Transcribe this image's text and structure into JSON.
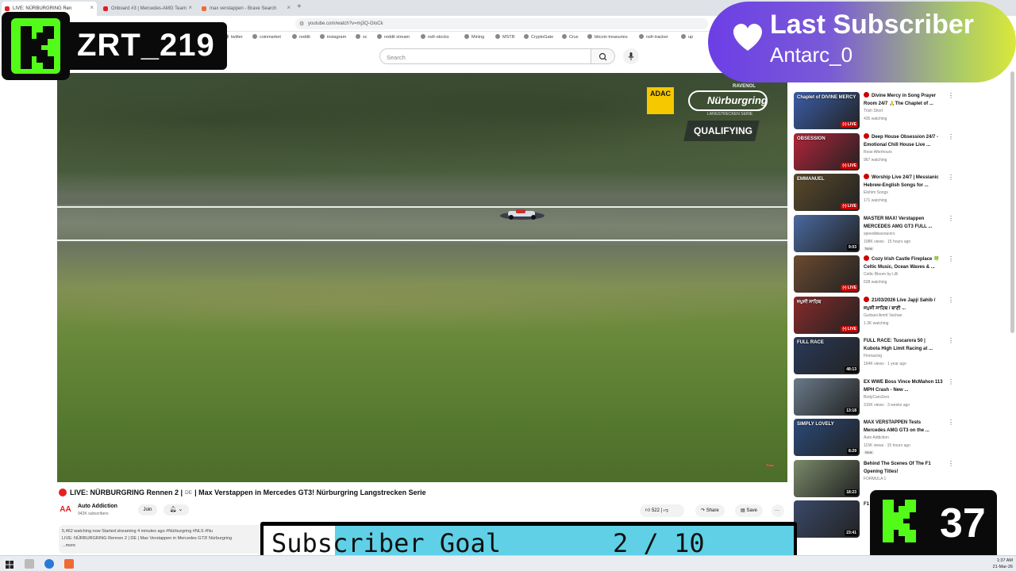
{
  "browser": {
    "tabs": [
      {
        "title": "LIVE: NÜRBURGRING Ren"
      },
      {
        "title": "Onboard #3 | Mercedes-AMG Team"
      },
      {
        "title": "max verstappen - Brave Search"
      }
    ],
    "url": "youtube.com/watch?v=mj3Q-GloCk",
    "bookmarks": [
      "twitter",
      "coinmarket",
      "reddit",
      "instagram",
      "sc",
      "reddit stream",
      "nsfr-stocks",
      "Mining",
      "MSTR",
      "CryptoGate",
      "Crux",
      "bitcoin treasuries",
      "nsfr-tracker",
      "up"
    ]
  },
  "header": {
    "search_placeholder": "Search"
  },
  "video": {
    "sponsor": "ADAC",
    "series_top": "RAVENOL",
    "series_name": "Nürburgring",
    "series_sub": "LANGSTRECKEN SERIE",
    "session": "QUALIFYING",
    "title": "LIVE: NÜRBURGRING Rennen 2 |",
    "lang": "DE",
    "title_rest": "| Max Verstappen in Mercedes GT3! Nürburgring Langstrecken Serie",
    "channel": "Auto Addiction",
    "subscribers": "942K subscribers",
    "join": "Join",
    "likes": "522",
    "share": "Share",
    "save": "Save",
    "desc_line1": "5,462 watching now  Started streaming 4 minutes ago  #Nürburgring #NLS #Nu",
    "desc_line2": "LIVE: NÜRBURGRING Rennen 2 | DE | Max Verstappen in Mercedes GT3! Nürburgring",
    "desc_more": "...more"
  },
  "recommendations": [
    {
      "title": "Divine Mercy in Song Prayer Room 24/7 🙏The Chaplet of ...",
      "channel": "Trish Short",
      "meta": "435 watching",
      "live": true,
      "thumb": "Chaplet of DIVINE MERCY",
      "color": "#3b5ea8"
    },
    {
      "title": "Deep House Obsession 24/7 - Emotional Chill House Live ...",
      "channel": "Rose Afterhours",
      "meta": "967 watching",
      "live": true,
      "thumb": "OBSESSION",
      "color": "#b3243a"
    },
    {
      "title": "Worship Live 24/7 | Messianic Hebrew-English Songs for ...",
      "channel": "Elohim Songs",
      "meta": "171 watching",
      "live": true,
      "thumb": "EMMANUEL",
      "color": "#5a4a2a"
    },
    {
      "title": "MASTER MAX! Verstappen MERCEDES AMG GT3 FULL ...",
      "channel": "speedideasracers",
      "meta": "108K views · 15 hours ago",
      "new": true,
      "duration": "9:03",
      "thumb": "",
      "color": "#4a6aa0"
    },
    {
      "title": "Cozy Irish Castle Fireplace 🍀 Celtic Music, Ocean Waves & ...",
      "channel": "Celtic Bloom by Lilli",
      "meta": "628 watching",
      "live": true,
      "thumb": "",
      "color": "#6b4a30"
    },
    {
      "title": "21/03/2026 Live Japji Sahib / ਜਪੁਜੀ ਸਾਹਿਬ / ਬਾਣੀ ...",
      "channel": "Gurbani Amrit Vachan",
      "meta": "1.3K watching",
      "live": true,
      "thumb": "ਜਪੁਜੀ ਸਾਹਿਬ",
      "color": "#8a2a2a"
    },
    {
      "title": "FULL RACE: Tuscarora 50 | Kubota High Limit Racing at ...",
      "channel": "Flomacing",
      "meta": "164K views · 1 year ago",
      "duration": "48:13",
      "thumb": "FULL RACE",
      "color": "#2a3a5a"
    },
    {
      "title": "EX WWE Boss Vince McMahon 113 MPH Crash - New ...",
      "channel": "BodyCamZero",
      "meta": "315K views · 3 weeks ago",
      "duration": "13:18",
      "thumb": "",
      "color": "#6a7a8a"
    },
    {
      "title": "MAX VERSTAPPEN Tests Mercedes AMG GT3 on the ...",
      "channel": "Auto Addiction",
      "meta": "115K views · 15 hours ago",
      "new": true,
      "duration": "8:29",
      "thumb": "SIMPLY LOVELY",
      "color": "#2a4a7a"
    },
    {
      "title": "Behind The Scenes Of The F1 Opening Titles!",
      "channel": "FORMULA 1",
      "meta": "",
      "duration": "18:23",
      "thumb": "",
      "color": "#7a8a6a"
    },
    {
      "title": "F1 ...",
      "channel": "",
      "meta": "",
      "duration": "23:41",
      "thumb": "",
      "color": "#3a4a6a"
    }
  ],
  "overlay": {
    "username": "ZRT_219",
    "last_sub_title": "Last Subscriber",
    "last_sub_name": "Antarc_0",
    "goal_label": "Subscriber Goal",
    "goal_count": "2 / 10",
    "goal_progress": 0.2,
    "follower_count": "37"
  },
  "taskbar": {
    "time": "1:37 AM",
    "date": "21-Mar-26"
  }
}
